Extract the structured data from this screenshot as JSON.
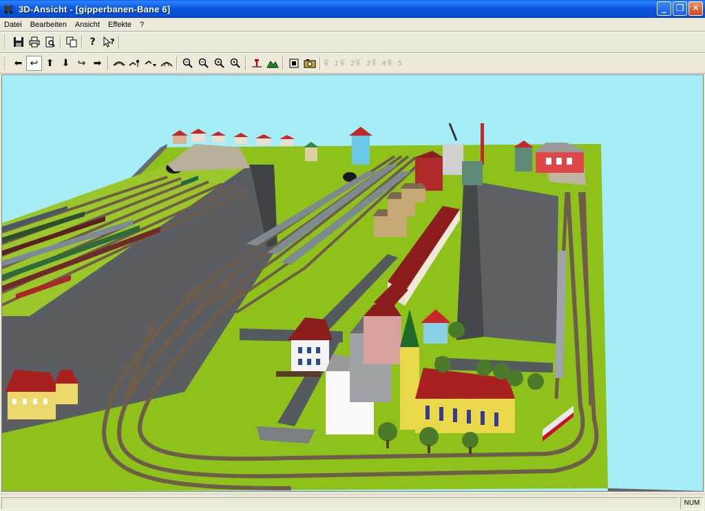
{
  "window": {
    "title": "3D-Ansicht - [gipperbanen-Bane 6]",
    "icon": "locomotive-icon"
  },
  "menu": {
    "items": [
      {
        "label": "Datei",
        "accel": "D"
      },
      {
        "label": "Bearbeiten",
        "accel": "B"
      },
      {
        "label": "Ansicht",
        "accel": "A"
      },
      {
        "label": "Effekte",
        "accel": "E"
      },
      {
        "label": "?",
        "accel": "?"
      }
    ]
  },
  "toolbar1": {
    "buttons": [
      {
        "name": "save-icon",
        "glyph": "💾"
      },
      {
        "name": "print-icon",
        "glyph": "🖶"
      },
      {
        "name": "print-preview-icon",
        "glyph": "🔍"
      },
      {
        "name": "copy-icon",
        "glyph": "⧉"
      },
      {
        "name": "help-icon",
        "glyph": "?"
      },
      {
        "name": "context-help-icon",
        "glyph": "⁇"
      }
    ]
  },
  "toolbar2": {
    "nav": [
      "arrow-left-icon",
      "turn-left-icon",
      "arrow-up-icon",
      "arrow-down-icon",
      "turn-right-icon",
      "arrow-right-icon"
    ],
    "view": [
      "view-tilt-up-icon",
      "view-tilt-walk-icon",
      "view-tilt-down-icon",
      "view-orbit-icon"
    ],
    "zoom": [
      "zoom-out-icon",
      "zoom-out-small-icon",
      "zoom-in-small-icon",
      "zoom-in-icon"
    ],
    "tools": [
      "signal-icon",
      "terrain-icon"
    ],
    "camera": [
      "fit-view-icon",
      "camera-icon"
    ],
    "presets": [
      {
        "name": "camera-preset-1-icon",
        "label": "1"
      },
      {
        "name": "camera-preset-2-icon",
        "label": "2"
      },
      {
        "name": "camera-preset-3-icon",
        "label": "3"
      },
      {
        "name": "camera-preset-4-icon",
        "label": "4"
      },
      {
        "name": "camera-preset-5-icon",
        "label": "5"
      }
    ]
  },
  "status": {
    "main": "",
    "num": "NUM"
  },
  "colors": {
    "sky": "#a5eef8",
    "grass": "#8ec21a",
    "track": "#7a6a55",
    "wall": "#5a5a5a"
  }
}
